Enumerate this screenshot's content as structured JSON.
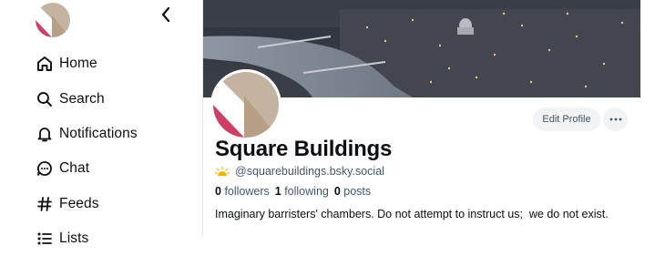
{
  "sidebar": {
    "avatar_icon": "avatar-logo",
    "collapse_icon": "chevron-left-icon",
    "items": [
      {
        "label": "Home",
        "icon": "home-icon"
      },
      {
        "label": "Search",
        "icon": "search-icon"
      },
      {
        "label": "Notifications",
        "icon": "bell-icon"
      },
      {
        "label": "Chat",
        "icon": "chat-icon"
      },
      {
        "label": "Feeds",
        "icon": "hash-icon"
      },
      {
        "label": "Lists",
        "icon": "list-icon"
      }
    ]
  },
  "profile": {
    "display_name": "Square Buildings",
    "handle": "@squarebuildings.bsky.social",
    "handle_icon": "sun-icon",
    "stats": {
      "followers_count": "0",
      "followers_label": "followers",
      "following_count": "1",
      "following_label": "following",
      "posts_count": "0",
      "posts_label": "posts"
    },
    "bio": "Imaginary barristers' chambers. Do not attempt to instruct us;  we do not exist.",
    "edit_button": "Edit Profile",
    "more_icon": "more-icon"
  },
  "colors": {
    "logo_beige": "#c4b3a0",
    "logo_brown": "#b79f85",
    "logo_pink": "#cf3e66",
    "secondary_text": "#42576c",
    "button_bg": "#f1f3f5"
  }
}
